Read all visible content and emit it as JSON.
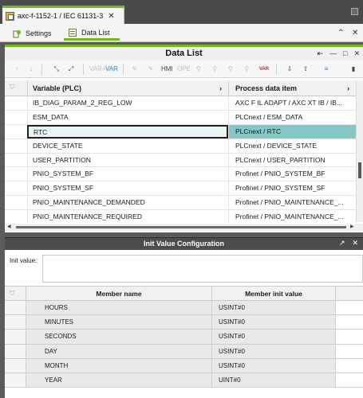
{
  "document_tab": {
    "title": "axc-f-1152-1 / IEC 61131-3",
    "close": "✕"
  },
  "sub_tabs": [
    {
      "label": "Settings"
    },
    {
      "label": "Data List"
    }
  ],
  "sub_controls": {
    "close": "✕",
    "collapse": "⌃",
    "menu": "⌄"
  },
  "data_list": {
    "title": "Data List",
    "panel_buttons": {
      "pin": "⇤",
      "min": "—",
      "max": "□",
      "close": "✕"
    },
    "columns": {
      "variable": "Variable (PLC)",
      "process": "Process data item"
    },
    "rows": [
      {
        "variable": "IB_DIAG_PARAM_2_REG_LOW",
        "process": "AXC F IL ADAPT / AXC XT IB / IB..."
      },
      {
        "variable": "ESM_DATA",
        "process": "PLCnext / ESM_DATA"
      },
      {
        "variable": "RTC",
        "process": "PLCnext / RTC",
        "selected": true
      },
      {
        "variable": "DEVICE_STATE",
        "process": "PLCnext / DEVICE_STATE"
      },
      {
        "variable": "USER_PARTITION",
        "process": "PLCnext / USER_PARTITION"
      },
      {
        "variable": "PNIO_SYSTEM_BF",
        "process": "Profinet / PNIO_SYSTEM_BF"
      },
      {
        "variable": "PNIO_SYSTEM_SF",
        "process": "Profinet / PNIO_SYSTEM_SF"
      },
      {
        "variable": "PNIO_MAINTENANCE_DEMANDED",
        "process": "Profinet / PNIO_MAINTENANCE_..."
      },
      {
        "variable": "PNIO_MAINTENANCE_REQUIRED",
        "process": "Profinet / PNIO_MAINTENANCE_..."
      }
    ],
    "toolbar": {
      "up": "↑",
      "down": "↓",
      "collapse": "⤡",
      "expand": "⤢",
      "var_add": "VAR+",
      "var_cfg": "VAR",
      "hmi": "HMI",
      "ope": "OPE",
      "var_del": "VAR",
      "export": "⇩",
      "list": "≡"
    }
  },
  "init_value": {
    "title": "Init Value Configuration",
    "panel_buttons": {
      "restore": "↗",
      "close": "✕"
    },
    "label": "Init value:",
    "value": "",
    "columns": {
      "name": "Member name",
      "value": "Member init value"
    },
    "members": [
      {
        "name": "HOURS",
        "value": "USINT#0"
      },
      {
        "name": "MINUTES",
        "value": "USINT#0"
      },
      {
        "name": "SECONDS",
        "value": "USINT#0"
      },
      {
        "name": "DAY",
        "value": "USINT#0"
      },
      {
        "name": "MONTH",
        "value": "USINT#0"
      },
      {
        "name": "YEAR",
        "value": "UINT#0"
      }
    ]
  },
  "colors": {
    "accent": "#74b81c",
    "selection": "#85c8c8",
    "dark": "#4c4c4c"
  }
}
